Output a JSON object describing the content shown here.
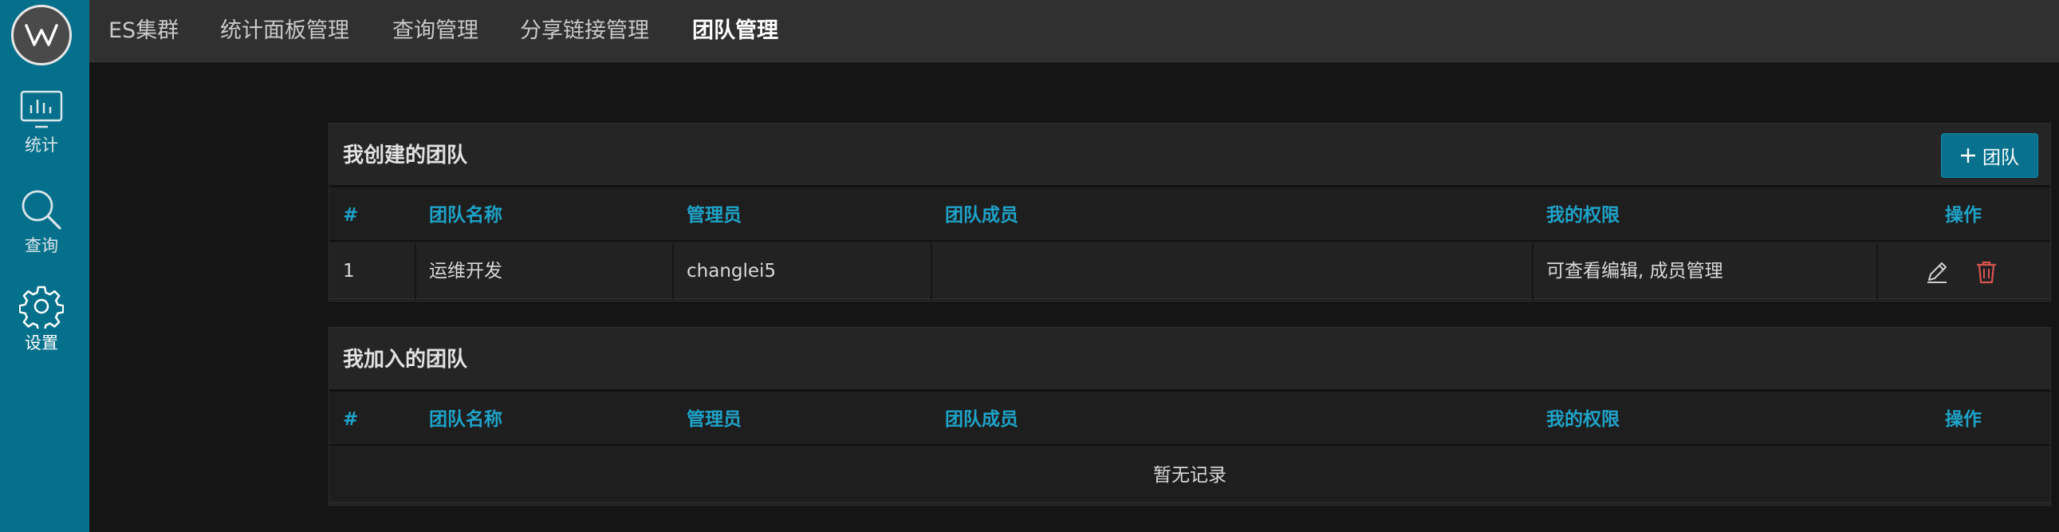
{
  "sidebar": {
    "items": [
      {
        "label": "统计",
        "icon": "chart-monitor-icon"
      },
      {
        "label": "查询",
        "icon": "search-icon"
      },
      {
        "label": "设置",
        "icon": "gear-icon",
        "active": true
      }
    ]
  },
  "topnav": [
    {
      "label": "ES集群"
    },
    {
      "label": "统计面板管理"
    },
    {
      "label": "查询管理"
    },
    {
      "label": "分享链接管理"
    },
    {
      "label": "团队管理",
      "active": true
    }
  ],
  "my_teams": {
    "title": "我创建的团队",
    "add_button": "团队",
    "columns": [
      "#",
      "团队名称",
      "管理员",
      "团队成员",
      "我的权限",
      "操作"
    ],
    "rows": [
      {
        "index": "1",
        "name": "运维开发",
        "admin": "changlei5",
        "members": "",
        "permission": "可查看编辑, 成员管理"
      }
    ]
  },
  "joined_teams": {
    "title": "我加入的团队",
    "columns": [
      "#",
      "团队名称",
      "管理员",
      "团队成员",
      "我的权限",
      "操作"
    ],
    "empty_text": "暂无记录"
  },
  "colors": {
    "sidebar": "#05708c",
    "accent_header": "#1ea3c9",
    "delete_icon": "#d9534f"
  }
}
